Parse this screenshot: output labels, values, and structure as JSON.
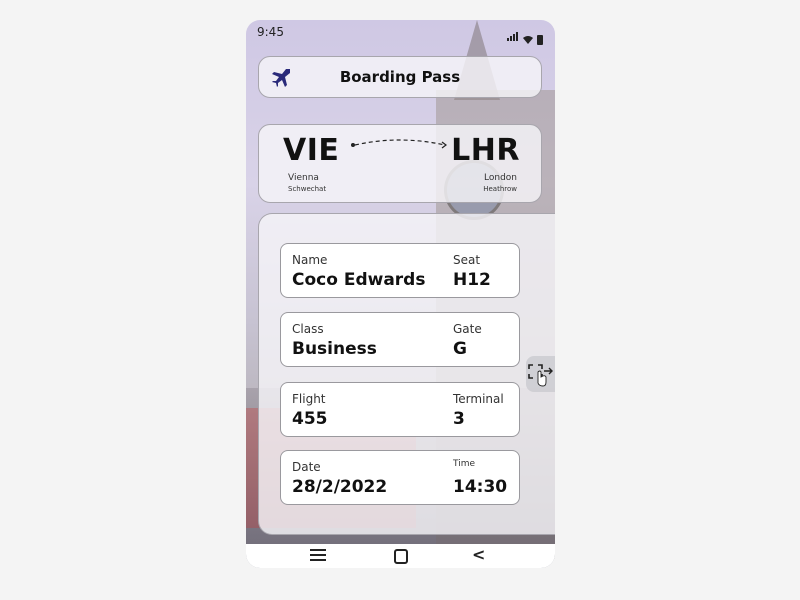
{
  "status_bar": {
    "time": "9:45",
    "wifi_icon": "▾"
  },
  "header": {
    "title": "Boarding Pass",
    "icon": "plane-icon",
    "icon_color": "#2a2a7a"
  },
  "route": {
    "from": {
      "code": "VIE",
      "city": "Vienna",
      "airport": "Schwechat"
    },
    "to": {
      "code": "LHR",
      "city": "London",
      "airport": "Heathrow"
    }
  },
  "details": [
    {
      "label": "Name",
      "value": "Coco Edwards",
      "label2": "Seat",
      "value2": "H12"
    },
    {
      "label": "Class",
      "value": "Business",
      "label2": "Gate",
      "value2": "G"
    },
    {
      "label": "Flight",
      "value": "455",
      "label2": "Terminal",
      "value2": "3"
    },
    {
      "label": "Date",
      "value": "28/2/2022",
      "label2": "Time",
      "value2": "14:30"
    }
  ],
  "navbar": {
    "back_glyph": "<"
  }
}
